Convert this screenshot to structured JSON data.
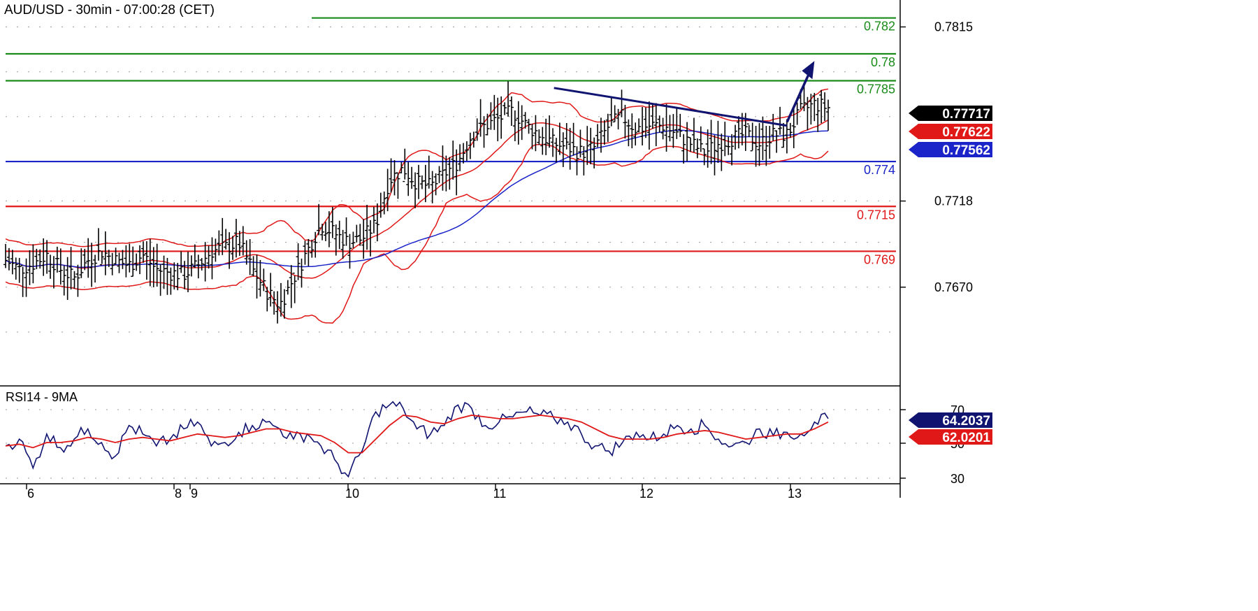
{
  "title": "AUD/USD - 30min - 07:00:28 (CET)",
  "colors": {
    "green": "#1a8c1a",
    "red": "#e01818",
    "blue": "#1a24c8",
    "navy": "#101470",
    "black": "#000000",
    "grid": "#9a9a9a"
  },
  "chart_data": [
    {
      "type": "line",
      "title": "AUD/USD - 30min - 07:00:28 (CET)",
      "x_ticks": [
        "6",
        "8",
        "9",
        "10",
        "11",
        "12",
        "13"
      ],
      "y_ticks": [
        "0.7815",
        "0.7718",
        "0.7670"
      ],
      "ylim": [
        0.7615,
        0.783
      ],
      "grid": true,
      "levels": [
        {
          "label": "0.782",
          "value": 0.782,
          "color": "#1a8c1a"
        },
        {
          "label": "0.78",
          "value": 0.78,
          "color": "#1a8c1a"
        },
        {
          "label": "0.7785",
          "value": 0.7785,
          "color": "#1a8c1a"
        },
        {
          "label": "0.774",
          "value": 0.774,
          "color": "#1a24c8"
        },
        {
          "label": "0.7715",
          "value": 0.7715,
          "color": "#e01818"
        },
        {
          "label": "0.769",
          "value": 0.769,
          "color": "#e01818"
        }
      ],
      "price_tags": [
        {
          "label": "0.77717",
          "value": 0.77717,
          "color": "#000000"
        },
        {
          "label": "0.77622",
          "value": 0.77622,
          "color": "#e01818"
        },
        {
          "label": "0.77562",
          "value": 0.77562,
          "color": "#1a24c8"
        }
      ],
      "price_path": [
        [
          0,
          0.7685
        ],
        [
          1,
          0.768
        ],
        [
          2,
          0.7683
        ],
        [
          3,
          0.7688
        ],
        [
          4,
          0.768
        ],
        [
          5,
          0.7675
        ],
        [
          6,
          0.7685
        ],
        [
          7,
          0.769
        ],
        [
          8,
          0.7685
        ],
        [
          9,
          0.7682
        ],
        [
          10,
          0.7688
        ],
        [
          11,
          0.768
        ],
        [
          12,
          0.7678
        ],
        [
          13,
          0.7677
        ],
        [
          14,
          0.7682
        ],
        [
          15,
          0.769
        ],
        [
          16,
          0.7692
        ],
        [
          17,
          0.7695
        ],
        [
          18,
          0.768
        ],
        [
          19,
          0.7668
        ],
        [
          20,
          0.766
        ],
        [
          21,
          0.7675
        ],
        [
          22,
          0.769
        ],
        [
          23,
          0.7705
        ],
        [
          24,
          0.77
        ],
        [
          25,
          0.7695
        ],
        [
          26,
          0.7697
        ],
        [
          27,
          0.7705
        ],
        [
          28,
          0.773
        ],
        [
          29,
          0.7736
        ],
        [
          30,
          0.7728
        ],
        [
          31,
          0.7726
        ],
        [
          32,
          0.7733
        ],
        [
          33,
          0.774
        ],
        [
          34,
          0.7755
        ],
        [
          35,
          0.776
        ],
        [
          36,
          0.7764
        ],
        [
          37,
          0.7768
        ],
        [
          38,
          0.776
        ],
        [
          39,
          0.7755
        ],
        [
          40,
          0.775
        ],
        [
          41,
          0.7748
        ],
        [
          42,
          0.7745
        ],
        [
          43,
          0.7748
        ],
        [
          44,
          0.776
        ],
        [
          45,
          0.7765
        ],
        [
          46,
          0.7758
        ],
        [
          47,
          0.776
        ],
        [
          48,
          0.776
        ],
        [
          49,
          0.7755
        ],
        [
          50,
          0.775
        ],
        [
          51,
          0.7745
        ],
        [
          52,
          0.775
        ],
        [
          53,
          0.7753
        ],
        [
          54,
          0.7755
        ],
        [
          55,
          0.775
        ],
        [
          56,
          0.7755
        ],
        [
          57,
          0.7755
        ],
        [
          58,
          0.7768
        ],
        [
          59,
          0.7772
        ],
        [
          60,
          0.777
        ]
      ],
      "trendline": {
        "start": [
          40,
          0.7781
        ],
        "end": [
          57,
          0.776
        ]
      },
      "projection": {
        "start": [
          57,
          0.7762
        ],
        "end": [
          59,
          0.7796
        ]
      }
    },
    {
      "type": "line",
      "title": "RSI14 - 9MA",
      "y_ticks": [
        "70",
        "50",
        "30"
      ],
      "ylim": [
        25,
        75
      ],
      "price_tags": [
        {
          "label": "64.2037",
          "value": 64.2037,
          "color": "#101470"
        },
        {
          "label": "62.0201",
          "value": 62.0201,
          "color": "#e01818"
        }
      ],
      "series": [
        {
          "values": [
            48,
            52,
            35,
            55,
            47,
            52,
            58,
            50,
            42,
            60,
            55,
            48,
            52,
            58,
            62,
            48,
            50,
            56,
            60,
            62,
            58,
            52,
            55,
            48,
            40,
            30,
            45,
            68,
            72,
            70,
            58,
            55,
            60,
            72,
            70,
            60,
            62,
            65,
            68,
            66,
            64,
            62,
            55,
            48,
            45,
            50,
            56,
            52,
            55,
            60,
            58,
            60,
            52,
            48,
            50,
            58,
            54,
            56,
            55,
            62,
            64
          ]
        },
        {
          "values": [
            48,
            49,
            47,
            50,
            50,
            51,
            53,
            52,
            50,
            52,
            53,
            52,
            51,
            53,
            55,
            54,
            53,
            54,
            56,
            58,
            58,
            56,
            55,
            54,
            50,
            44,
            44,
            52,
            60,
            66,
            65,
            62,
            61,
            64,
            66,
            65,
            64,
            64,
            65,
            66,
            65,
            64,
            62,
            58,
            54,
            52,
            52,
            52,
            53,
            55,
            56,
            57,
            56,
            54,
            52,
            53,
            54,
            55,
            55,
            58,
            62
          ]
        }
      ]
    }
  ]
}
